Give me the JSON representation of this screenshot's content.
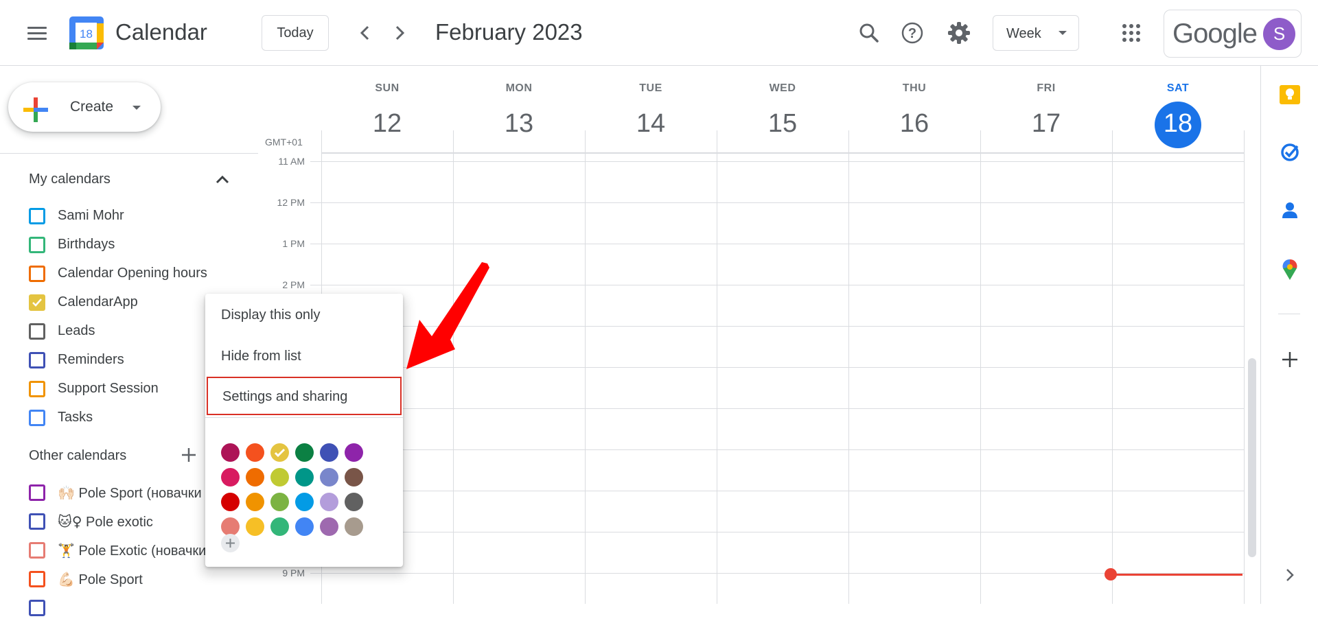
{
  "header": {
    "logo_day": "18",
    "app_title": "Calendar",
    "today_label": "Today",
    "month_title": "February 2023",
    "view_label": "Week",
    "google_wordmark": "Google",
    "avatar_initial": "S"
  },
  "sidebar": {
    "create_label": "Create",
    "my_calendars_title": "My calendars",
    "my_calendars": [
      {
        "name": "Sami Mohr",
        "color": "#039be5",
        "checked": false
      },
      {
        "name": "Birthdays",
        "color": "#33b679",
        "checked": false
      },
      {
        "name": "Calendar Opening hours",
        "color": "#ef6c00",
        "checked": false
      },
      {
        "name": "CalendarApp",
        "color": "#e4c441",
        "checked": true
      },
      {
        "name": "Leads",
        "color": "#616161",
        "checked": false
      },
      {
        "name": "Reminders",
        "color": "#3f51b5",
        "checked": false
      },
      {
        "name": "Support Session",
        "color": "#f09300",
        "checked": false
      },
      {
        "name": "Tasks",
        "color": "#4285f4",
        "checked": false
      }
    ],
    "other_calendars_title": "Other calendars",
    "other_calendars": [
      {
        "name": "🙌🏻 Pole Sport (новачки",
        "color": "#8e24aa"
      },
      {
        "name": "🐱‍♀ Pole exotic",
        "color": "#3f51b5"
      },
      {
        "name": "🏋 Pole Exotic (новачки",
        "color": "#e67c73"
      },
      {
        "name": "💪🏻 Pole Sport",
        "color": "#f4511e"
      },
      {
        "name": "",
        "color": "#3f51b5"
      }
    ]
  },
  "week": {
    "timezone": "GMT+01",
    "days": [
      {
        "dow": "SUN",
        "num": "12",
        "today": false
      },
      {
        "dow": "MON",
        "num": "13",
        "today": false
      },
      {
        "dow": "TUE",
        "num": "14",
        "today": false
      },
      {
        "dow": "WED",
        "num": "15",
        "today": false
      },
      {
        "dow": "THU",
        "num": "16",
        "today": false
      },
      {
        "dow": "FRI",
        "num": "17",
        "today": false
      },
      {
        "dow": "SAT",
        "num": "18",
        "today": true
      }
    ],
    "time_labels": [
      "11 AM",
      "12 PM",
      "1 PM",
      "2 PM",
      "",
      "",
      "",
      "",
      "",
      "",
      "9 PM"
    ]
  },
  "context_menu": {
    "items": [
      "Display this only",
      "Hide from list",
      "Settings and sharing"
    ],
    "highlighted_item": "Settings and sharing",
    "color_rows": [
      [
        "#ad1457",
        "#f4511e",
        "#e4c441",
        "#0b8043",
        "#3f51b5",
        "#8e24aa"
      ],
      [
        "#d81b60",
        "#ef6c00",
        "#c0ca33",
        "#009688",
        "#7986cb",
        "#795548"
      ],
      [
        "#d50000",
        "#f09300",
        "#7cb342",
        "#039be5",
        "#b39ddb",
        "#616161"
      ],
      [
        "#e67c73",
        "#f6bf26",
        "#33b679",
        "#4285f4",
        "#9e69af",
        "#a79b8e"
      ]
    ],
    "selected_color": "#e4c441"
  },
  "annotation": {
    "arrow_color": "#ff0000"
  }
}
